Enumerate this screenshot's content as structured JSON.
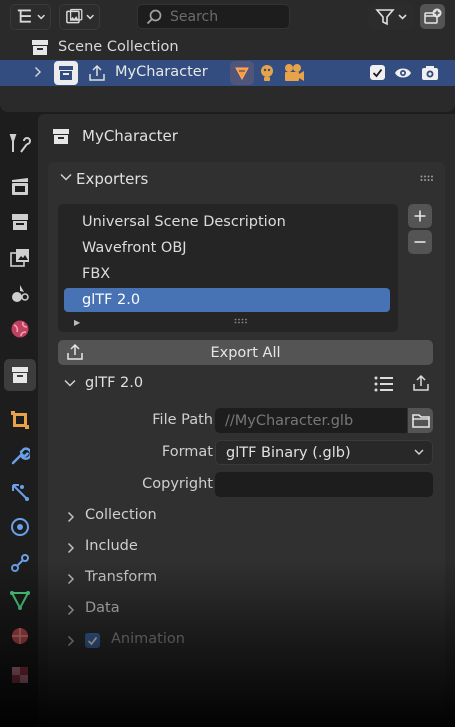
{
  "outliner": {
    "search_placeholder": "Search",
    "scene_collection_label": "Scene Collection",
    "object_label": "MyCharacter",
    "object_visible_checked": true
  },
  "properties": {
    "header_label": "MyCharacter",
    "exporters_panel": {
      "title": "Exporters",
      "list_items": [
        {
          "label": "Universal Scene Description",
          "selected": false
        },
        {
          "label": "Wavefront OBJ",
          "selected": false
        },
        {
          "label": "FBX",
          "selected": false
        },
        {
          "label": "glTF 2.0",
          "selected": true
        }
      ],
      "add_label": "+",
      "remove_label": "−",
      "export_all_label": "Export All"
    },
    "gltf": {
      "title": "glTF 2.0",
      "file_path_label": "File Path",
      "file_path_value": "//MyCharacter.glb",
      "format_label": "Format",
      "format_value": "glTF Binary (.glb)",
      "copyright_label": "Copyright",
      "copyright_value": "",
      "subpanels": [
        "Collection",
        "Include",
        "Transform",
        "Data"
      ],
      "animation_label": "Animation",
      "animation_checked": true
    }
  },
  "colors": {
    "selection_blue": "#4772b3",
    "outliner_active_row": "#334d80",
    "panel_bg": "#303030"
  }
}
